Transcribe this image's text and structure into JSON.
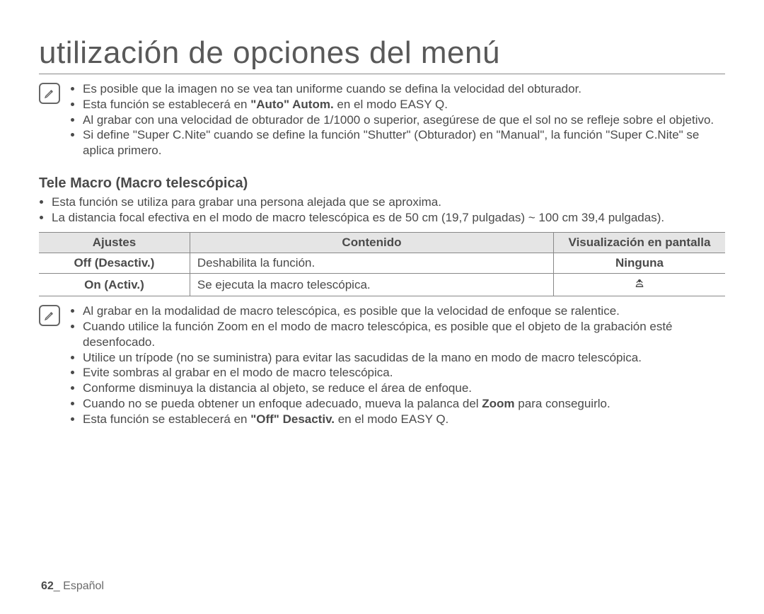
{
  "title": "utilización de opciones del menú",
  "note1": {
    "items": [
      {
        "prefix": "Es posible que la imagen no se vea tan uniforme cuando se defina la velocidad del obturador."
      },
      {
        "prefix": "Esta función se establecerá en ",
        "bold": "\"Auto\" Autom.",
        "suffix": " en el modo EASY Q."
      },
      {
        "prefix": "Al grabar con una velocidad de obturador de 1/1000 o superior, asegúrese de que el sol no se refleje sobre el objetivo."
      },
      {
        "prefix": "Si define \"Super C.Nite\" cuando se define la función \"Shutter\" (Obturador) en \"Manual\", la función \"Super C.Nite\" se aplica primero."
      }
    ]
  },
  "section": {
    "heading": "Tele Macro (Macro telescópica)",
    "intro": [
      "Esta función se utiliza para grabar una persona alejada que se aproxima.",
      "La distancia focal efectiva en el modo de macro telescópica es de 50 cm (19,7 pulgadas) ~ 100 cm 39,4 pulgadas)."
    ],
    "table": {
      "headers": [
        "Ajustes",
        "Contenido",
        "Visualización en pantalla"
      ],
      "rows": [
        {
          "settings": "Off (Desactiv.)",
          "content": "Deshabilita la función.",
          "display": "Ninguna",
          "displayType": "text"
        },
        {
          "settings": "On (Activ.)",
          "content": "Se ejecuta la macro telescópica.",
          "display": "",
          "displayType": "icon"
        }
      ]
    }
  },
  "note2": {
    "items": [
      {
        "prefix": "Al grabar en la modalidad de macro telescópica, es posible que la velocidad de enfoque se ralentice."
      },
      {
        "prefix": "Cuando utilice la función Zoom en el modo de macro telescópica, es posible que el objeto de la grabación esté desenfocado."
      },
      {
        "prefix": "Utilice un trípode (no se suministra) para evitar las sacudidas de la mano en modo de macro telescópica."
      },
      {
        "prefix": "Evite sombras al grabar en el modo de macro telescópica."
      },
      {
        "prefix": "Conforme disminuya la distancia al objeto, se reduce el área de enfoque."
      },
      {
        "prefix": "Cuando no se pueda obtener un enfoque adecuado, mueva la palanca del ",
        "bold": "Zoom",
        "suffix": " para conseguirlo."
      },
      {
        "prefix": "Esta función se establecerá en ",
        "bold": "\"Off\" Desactiv.",
        "suffix": " en el modo EASY Q."
      }
    ]
  },
  "footer": {
    "page": "62",
    "sep": "_ ",
    "lang": "Español"
  }
}
